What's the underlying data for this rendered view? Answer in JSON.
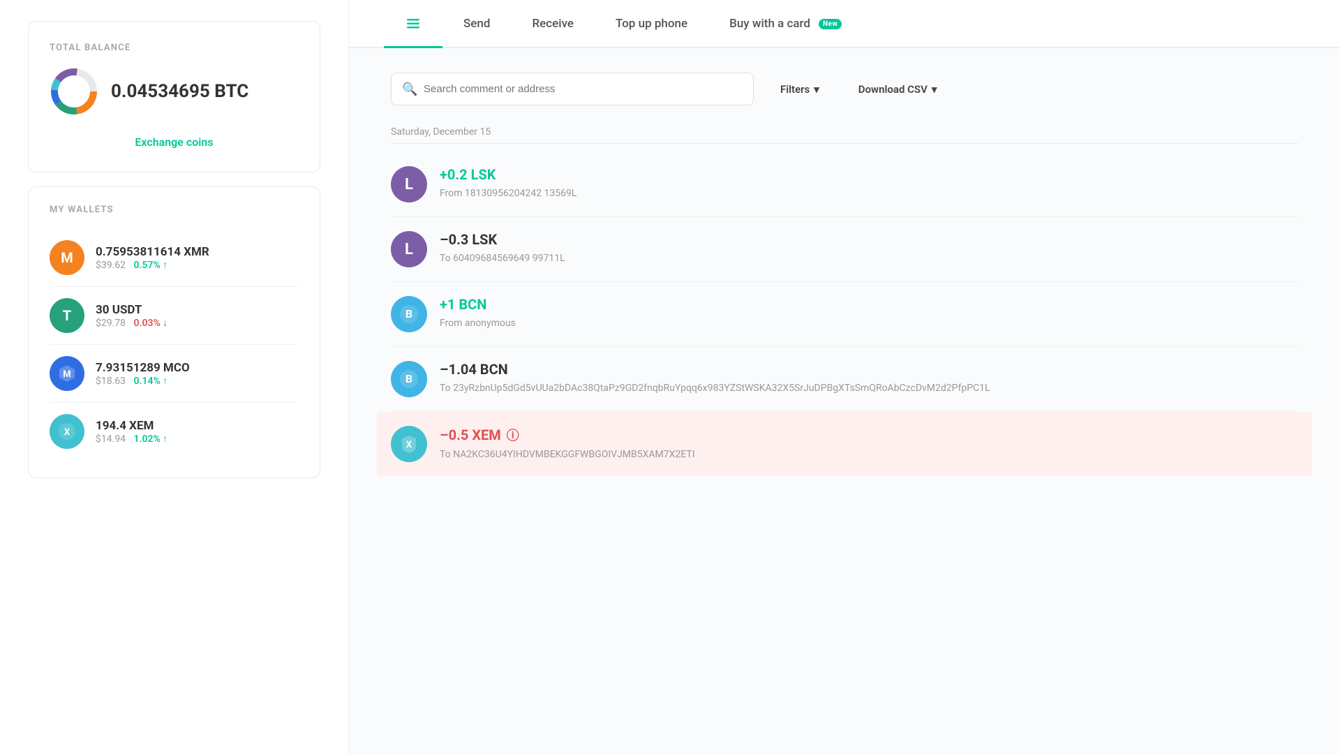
{
  "sidebar": {
    "total_balance_label": "TOTAL BALANCE",
    "balance_amount": "0.04534695 BTC",
    "exchange_btn_label": "Exchange coins",
    "my_wallets_label": "MY WALLETS",
    "wallets": [
      {
        "id": "xmr",
        "symbol": "XMR",
        "icon_letter": "M",
        "icon_bg": "#f5811f",
        "amount": "0.75953811614 XMR",
        "usd": "$39.62",
        "change": "0.57% ↑",
        "change_dir": "up"
      },
      {
        "id": "usdt",
        "symbol": "USDT",
        "icon_letter": "T",
        "icon_bg": "#26a17b",
        "amount": "30 USDT",
        "usd": "$29.78",
        "change": "0.03% ↓",
        "change_dir": "down"
      },
      {
        "id": "mco",
        "symbol": "MCO",
        "icon_letter": "M",
        "icon_bg": "#2f6de3",
        "amount": "7.93151289 MCO",
        "usd": "$18.63",
        "change": "0.14% ↑",
        "change_dir": "up"
      },
      {
        "id": "xem",
        "symbol": "XEM",
        "icon_letter": "X",
        "icon_bg": "#41c0cf",
        "amount": "194.4 XEM",
        "usd": "$14.94",
        "change": "1.02% ↑",
        "change_dir": "up"
      }
    ]
  },
  "tabs": [
    {
      "id": "history",
      "label": "",
      "icon": "list-icon",
      "active": true
    },
    {
      "id": "send",
      "label": "Send",
      "active": false
    },
    {
      "id": "receive",
      "label": "Receive",
      "active": false
    },
    {
      "id": "topup",
      "label": "Top up phone",
      "active": false
    },
    {
      "id": "buy",
      "label": "Buy with a card",
      "badge": "New",
      "active": false
    }
  ],
  "search": {
    "placeholder": "Search comment or address"
  },
  "filters": {
    "label": "Filters",
    "csv_label": "Download CSV"
  },
  "date_label": "Saturday, December 15",
  "transactions": [
    {
      "id": "tx1",
      "icon_letter": "L",
      "icon_bg": "#7b5ea7",
      "amount": "+0.2 LSK",
      "amount_type": "positive",
      "direction": "From",
      "address": "18130956204242 13569L",
      "full_address": "181309562042421 3569L"
    },
    {
      "id": "tx2",
      "icon_letter": "L",
      "icon_bg": "#7b5ea7",
      "amount": "–0.3 LSK",
      "amount_type": "negative",
      "direction": "To",
      "address": "60409684569649 99711L",
      "full_address": "6040968456964999711L"
    },
    {
      "id": "tx3",
      "icon_letter": "B",
      "icon_bg": "#41b4e6",
      "icon_symbol": "₿",
      "amount": "+1 BCN",
      "amount_type": "positive",
      "direction": "From",
      "address": "anonymous"
    },
    {
      "id": "tx4",
      "icon_letter": "B",
      "icon_bg": "#41b4e6",
      "icon_symbol": "₿",
      "amount": "–1.04 BCN",
      "amount_type": "negative",
      "direction": "To",
      "address": "23yRzbnUp5dGd5vUUa2bDAc38QtaPz9GD2fnqbRuYpqq6x983YZStWSKA32X5SrJuDPBgXTsSmQRoAbCzcDvM2d2PfpPC1L"
    },
    {
      "id": "tx5",
      "icon_letter": "X",
      "icon_bg": "#41c0cf",
      "amount": "–0.5 XEM",
      "amount_type": "error",
      "direction": "To",
      "address": "NA2KC36U4YIHDVMBEKGGFWBGOIVJMB5XAM7X2ETI",
      "highlighted": true,
      "has_error": true
    }
  ],
  "colors": {
    "accent": "#00c896",
    "negative": "#333",
    "error": "#e05050",
    "positive": "#00c896"
  }
}
